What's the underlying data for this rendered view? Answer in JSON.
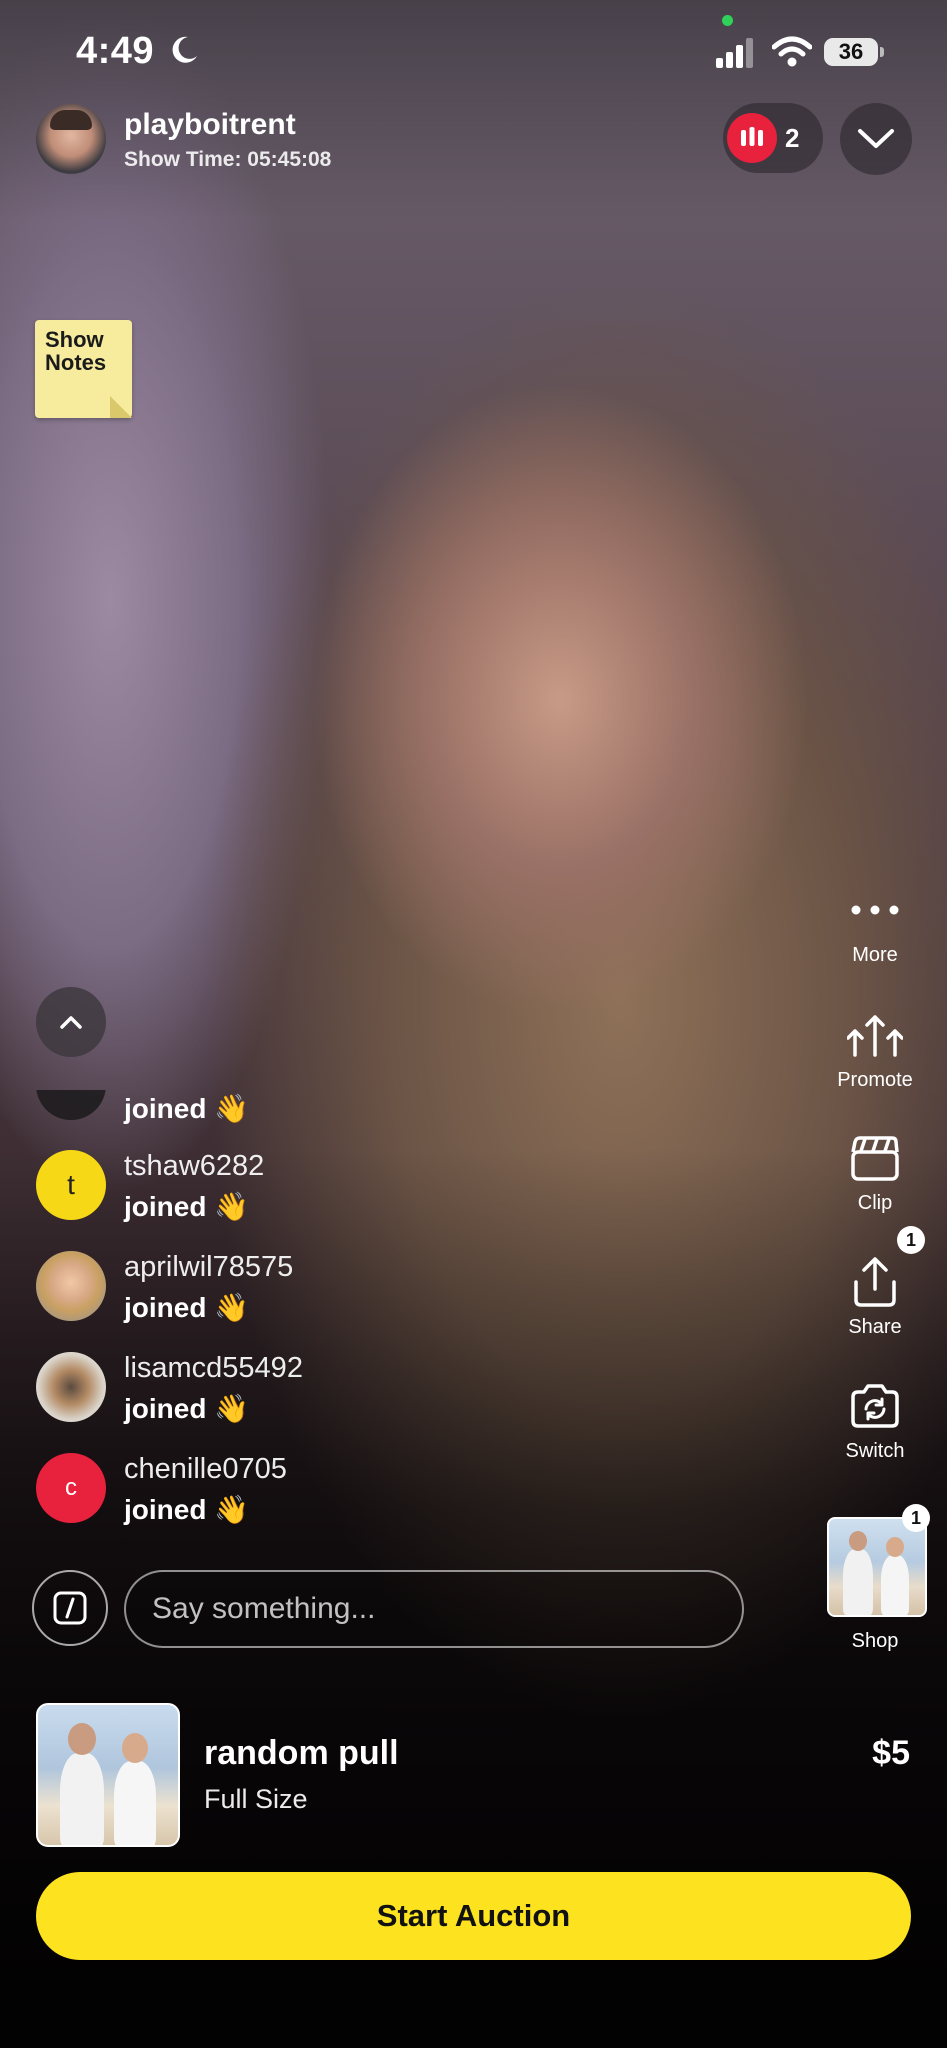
{
  "status_bar": {
    "time": "4:49",
    "battery": "36"
  },
  "header": {
    "username": "playboitrent",
    "show_time": "Show Time: 05:45:08",
    "viewer_count": "2"
  },
  "show_notes": {
    "label_line1": "Show",
    "label_line2": "Notes"
  },
  "actions": {
    "more": "More",
    "promote": "Promote",
    "clip": "Clip",
    "share": "Share",
    "share_badge": "1",
    "switch": "Switch",
    "shop": "Shop",
    "shop_badge": "1"
  },
  "chat": {
    "partial_message": "joined 👋",
    "messages": [
      {
        "avatar_letter": "t",
        "username": "tshaw6282",
        "message": "joined 👋",
        "avatar_color": "#f6d817"
      },
      {
        "avatar_letter": "",
        "username": "aprilwil78575",
        "message": "joined 👋"
      },
      {
        "avatar_letter": "",
        "username": "lisamcd55492",
        "message": "joined 👋"
      },
      {
        "avatar_letter": "c",
        "username": "chenille0705",
        "message": "joined 👋",
        "avatar_color": "#e8213d"
      }
    ],
    "input_placeholder": "Say something..."
  },
  "product": {
    "title": "random pull",
    "subtitle": "Full Size",
    "price": "$5"
  },
  "cta": {
    "start_auction": "Start Auction"
  },
  "colors": {
    "accent_yellow": "#fde31f",
    "live_red": "#e8213d"
  }
}
